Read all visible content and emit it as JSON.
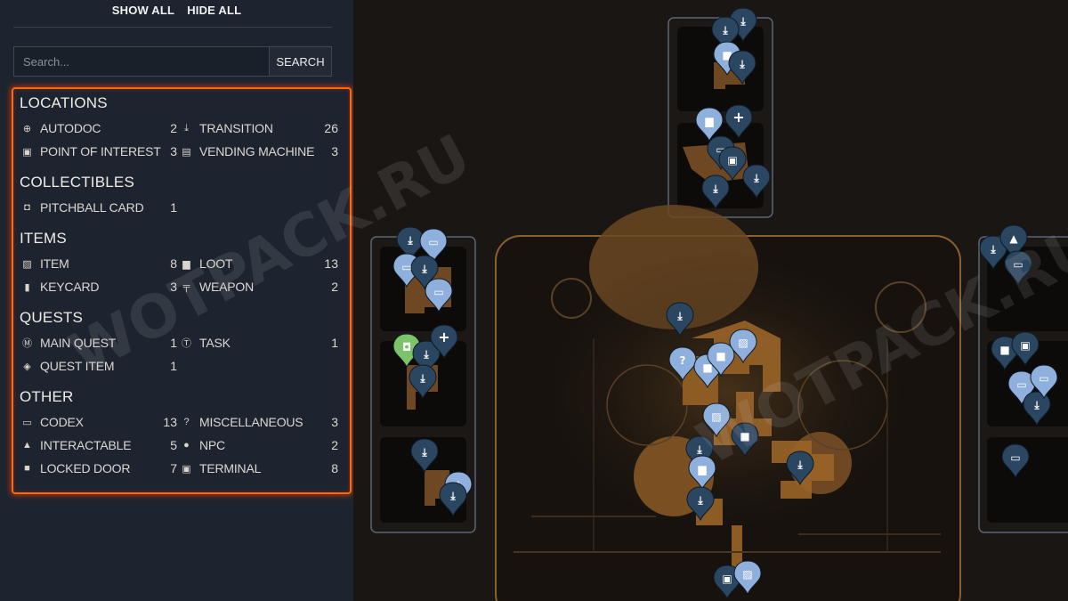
{
  "sidebar": {
    "show_all": "SHOW ALL",
    "hide_all": "HIDE ALL",
    "search": {
      "placeholder": "Search...",
      "button": "SEARCH"
    },
    "sections": [
      {
        "title": "LOCATIONS",
        "items": [
          {
            "icon": "plus-circle-icon",
            "glyph": "⊕",
            "label": "AUTODOC",
            "count": "2"
          },
          {
            "icon": "download-icon",
            "glyph": "⤓",
            "label": "TRANSITION",
            "count": "26"
          },
          {
            "icon": "poi-square-icon",
            "glyph": "▣",
            "label": "POINT OF INTEREST",
            "count": "3"
          },
          {
            "icon": "vending-machine-icon",
            "glyph": "▤",
            "label": "VENDING MACHINE",
            "count": "3"
          }
        ]
      },
      {
        "title": "COLLECTIBLES",
        "items": [
          {
            "icon": "card-icon",
            "glyph": "◘",
            "label": "PITCHBALL CARD",
            "count": "1"
          }
        ]
      },
      {
        "title": "ITEMS",
        "items": [
          {
            "icon": "item-icon",
            "glyph": "▨",
            "label": "ITEM",
            "count": "8"
          },
          {
            "icon": "loot-box-icon",
            "glyph": "▆",
            "label": "LOOT",
            "count": "13"
          },
          {
            "icon": "keycard-icon",
            "glyph": "▮",
            "label": "KEYCARD",
            "count": "3"
          },
          {
            "icon": "weapon-icon",
            "glyph": "╤",
            "label": "WEAPON",
            "count": "2"
          }
        ]
      },
      {
        "title": "QUESTS",
        "items": [
          {
            "icon": "main-quest-icon",
            "glyph": "Ⓜ",
            "label": "MAIN QUEST",
            "count": "1"
          },
          {
            "icon": "task-icon",
            "glyph": "Ⓣ",
            "label": "TASK",
            "count": "1"
          },
          {
            "icon": "quest-item-icon",
            "glyph": "◈",
            "label": "QUEST ITEM",
            "count": "1"
          }
        ]
      },
      {
        "title": "OTHER",
        "items": [
          {
            "icon": "codex-icon",
            "glyph": "▭",
            "label": "CODEX",
            "count": "13"
          },
          {
            "icon": "question-icon",
            "glyph": "?",
            "label": "MISCELLANEOUS",
            "count": "3"
          },
          {
            "icon": "triangle-icon",
            "glyph": "▲",
            "label": "INTERACTABLE",
            "count": "5"
          },
          {
            "icon": "person-icon",
            "glyph": "●",
            "label": "NPC",
            "count": "2"
          },
          {
            "icon": "lock-icon",
            "glyph": "■",
            "label": "LOCKED DOOR",
            "count": "7"
          },
          {
            "icon": "terminal-icon",
            "glyph": "▣",
            "label": "TERMINAL",
            "count": "8"
          }
        ]
      }
    ]
  },
  "watermark": "WOTPACK.RU",
  "colors": {
    "sidebar_bg": "#1d2430",
    "map_bg": "#1a1613",
    "highlight": "#ff6a00",
    "marker_dark": "#2b4660",
    "marker_light": "#8fb0dc",
    "marker_green": "#7cc36a",
    "map_bronze": "#a06a2c"
  },
  "map_markers": [
    {
      "kind": "download",
      "color": "dark"
    },
    {
      "kind": "download",
      "color": "dark"
    },
    {
      "kind": "lock",
      "color": "light"
    },
    {
      "kind": "download",
      "color": "dark"
    },
    {
      "kind": "loot",
      "color": "light"
    },
    {
      "kind": "plus",
      "color": "dark"
    },
    {
      "kind": "codex",
      "color": "dark"
    },
    {
      "kind": "terminal",
      "color": "dark"
    },
    {
      "kind": "download",
      "color": "dark"
    },
    {
      "kind": "download",
      "color": "dark"
    },
    {
      "kind": "download",
      "color": "dark"
    },
    {
      "kind": "codex",
      "color": "light"
    },
    {
      "kind": "codex",
      "color": "light"
    },
    {
      "kind": "download",
      "color": "dark"
    },
    {
      "kind": "codex",
      "color": "light"
    },
    {
      "kind": "card",
      "color": "green"
    },
    {
      "kind": "download",
      "color": "dark"
    },
    {
      "kind": "plus",
      "color": "dark"
    },
    {
      "kind": "download",
      "color": "dark"
    },
    {
      "kind": "download",
      "color": "dark"
    },
    {
      "kind": "download",
      "color": "light"
    },
    {
      "kind": "download",
      "color": "dark"
    },
    {
      "kind": "download",
      "color": "dark"
    },
    {
      "kind": "item",
      "color": "light"
    },
    {
      "kind": "question",
      "color": "light"
    },
    {
      "kind": "lock",
      "color": "light"
    },
    {
      "kind": "lock",
      "color": "light"
    },
    {
      "kind": "item",
      "color": "light"
    },
    {
      "kind": "lock",
      "color": "dark"
    },
    {
      "kind": "download",
      "color": "dark"
    },
    {
      "kind": "loot",
      "color": "light"
    },
    {
      "kind": "download",
      "color": "dark"
    },
    {
      "kind": "terminal",
      "color": "dark"
    },
    {
      "kind": "item",
      "color": "light"
    },
    {
      "kind": "download",
      "color": "dark"
    },
    {
      "kind": "download",
      "color": "dark"
    },
    {
      "kind": "triangle",
      "color": "dark"
    },
    {
      "kind": "codex",
      "color": "dark"
    },
    {
      "kind": "lock",
      "color": "dark"
    },
    {
      "kind": "poi",
      "color": "dark"
    },
    {
      "kind": "codex",
      "color": "light"
    },
    {
      "kind": "download",
      "color": "dark"
    },
    {
      "kind": "codex",
      "color": "light"
    },
    {
      "kind": "codex",
      "color": "dark"
    }
  ]
}
